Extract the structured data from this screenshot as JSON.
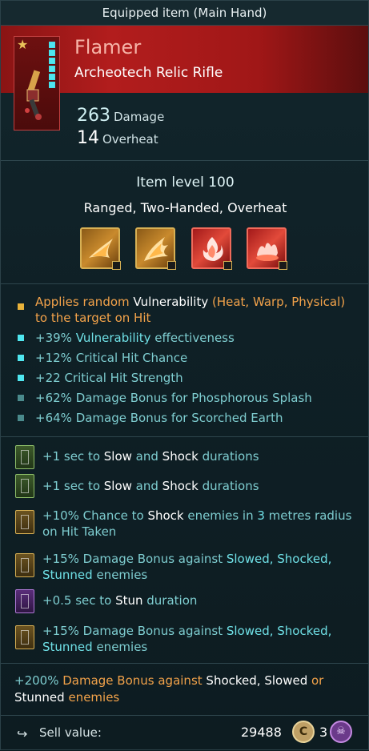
{
  "window": {
    "title": "Equipped item (Main Hand)"
  },
  "item": {
    "name": "Flamer",
    "type": "Archeotech Relic Rifle",
    "damage_value": "263",
    "damage_label": "Damage",
    "overheat_value": "14",
    "overheat_label": "Overheat",
    "item_level": "Item level 100",
    "tags": "Ranged, Two-Handed, Overheat",
    "quality_pips_lit": 6
  },
  "abilities": [
    {
      "icon": "flame-wave-icon",
      "style": "gold"
    },
    {
      "icon": "flame-burst-icon",
      "style": "gold"
    },
    {
      "icon": "fire-icon",
      "style": "red"
    },
    {
      "icon": "scorched-earth-icon",
      "style": "red"
    }
  ],
  "modifiers": {
    "m1": {
      "a": "Applies random ",
      "b": "Vulnerability",
      "c": " (Heat, Warp, Physical)",
      "d": "to the target on Hit"
    },
    "m2": {
      "a": "+39% ",
      "b": "Vulnerability",
      "c": " effectiveness"
    },
    "m3": {
      "a": "+12% ",
      "b": "Critical Hit Chance"
    },
    "m4": {
      "a": "+22 ",
      "b": "Critical Hit Strength"
    },
    "m5": {
      "a": "+62% ",
      "b": "Damage Bonus for Phosphorous Splash"
    },
    "m6": {
      "a": "+64% ",
      "b": "Damage Bonus for Scorched Earth"
    }
  },
  "runes": {
    "r1": {
      "a": "+1 sec to ",
      "b": "Slow",
      "c": " and ",
      "d": "Shock",
      "e": " durations"
    },
    "r2": {
      "a": "+1 sec to ",
      "b": "Slow",
      "c": " and ",
      "d": "Shock",
      "e": " durations"
    },
    "r3": {
      "a": "+10% Chance to ",
      "b": "Shock",
      "c": " enemies in ",
      "d": "3",
      "e": " metres radius",
      "f": "on Hit Taken"
    },
    "r4": {
      "a": "+15% Damage Bonus against ",
      "b": "Slowed, Shocked,",
      "c": "Stunned",
      "d": " enemies"
    },
    "r5": {
      "a": "+0.5 sec to ",
      "b": "Stun",
      "c": " duration"
    },
    "r6": {
      "a": "+15% Damage Bonus against ",
      "b": "Slowed, Shocked,",
      "c": "Stunned",
      "d": " enemies"
    }
  },
  "bonus": {
    "a": "+200% ",
    "b": "Damage Bonus against ",
    "c": "Shocked",
    "d": ", ",
    "e": "Slowed",
    "f": " or",
    "g": "Stunned",
    "h": " enemies"
  },
  "footer": {
    "sell_label": "Sell value:",
    "sell_value": "29488",
    "coin_glyph": "C",
    "skull_count": "3",
    "skull_glyph": "☠"
  },
  "colors": {
    "header_red": "#b21d1d",
    "affix_cyan": "#7ecdd0",
    "highlight_orange": "#f2a24a",
    "pip_cyan": "#4fe6ef"
  }
}
